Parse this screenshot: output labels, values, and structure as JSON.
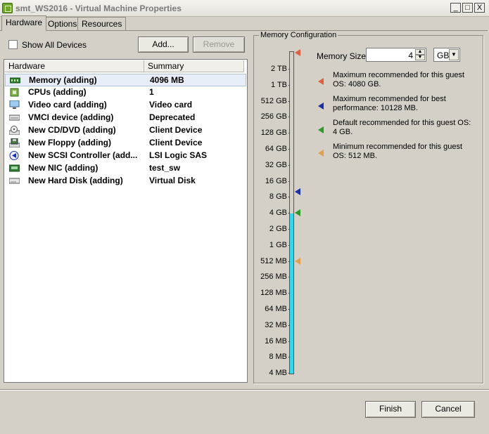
{
  "window": {
    "title": "smt_WS2016 - Virtual Machine Properties",
    "min": "_",
    "max": "□",
    "close": "X"
  },
  "tabs": [
    {
      "label": "Hardware"
    },
    {
      "label": "Options"
    },
    {
      "label": "Resources"
    }
  ],
  "show_all_devices": {
    "label": "Show All Devices",
    "checked": false
  },
  "buttons": {
    "add": "Add...",
    "remove": "Remove",
    "finish": "Finish",
    "cancel": "Cancel"
  },
  "table": {
    "headers": [
      "Hardware",
      "Summary"
    ],
    "rows": [
      {
        "name": "Memory (adding)",
        "summary": "4096 MB",
        "icon": "memory-icon"
      },
      {
        "name": "CPUs (adding)",
        "summary": "1",
        "icon": "cpu-icon"
      },
      {
        "name": "Video card  (adding)",
        "summary": "Video card",
        "icon": "monitor-icon"
      },
      {
        "name": "VMCI device (adding)",
        "summary": "Deprecated",
        "icon": "device-icon"
      },
      {
        "name": "New CD/DVD (adding)",
        "summary": "Client Device",
        "icon": "cd-dvd-icon"
      },
      {
        "name": "New Floppy (adding)",
        "summary": "Client Device",
        "icon": "floppy-icon"
      },
      {
        "name": "New SCSI Controller (add...",
        "summary": "LSI Logic SAS",
        "icon": "scsi-icon"
      },
      {
        "name": "New NIC (adding)",
        "summary": "test_sw",
        "icon": "nic-icon"
      },
      {
        "name": "New Hard Disk (adding)",
        "summary": "Virtual Disk",
        "icon": "harddisk-icon"
      }
    ]
  },
  "memory_config": {
    "title": "Memory Configuration",
    "size_label": "Memory Size:",
    "size_value": "4",
    "unit": "GB",
    "scale_labels": [
      "2 TB",
      "1 TB",
      "512 GB",
      "256 GB",
      "128 GB",
      "64 GB",
      "32 GB",
      "16 GB",
      "8 GB",
      "4 GB",
      "2 GB",
      "1 GB",
      "512 MB",
      "256 MB",
      "128 MB",
      "64 MB",
      "32 MB",
      "16 MB",
      "8 MB",
      "4 MB"
    ],
    "legend": [
      {
        "text": "Maximum recommended for this guest OS: 4080 GB.",
        "color": "#e06040"
      },
      {
        "text": "Maximum recommended for best performance: 10128 MB.",
        "color": "#1a2fa8"
      },
      {
        "text": "Default recommended for this guest OS: 4 GB.",
        "color": "#2a9a2a"
      },
      {
        "text": "Minimum recommended for this guest OS: 512 MB.",
        "color": "#e0a050"
      }
    ]
  }
}
